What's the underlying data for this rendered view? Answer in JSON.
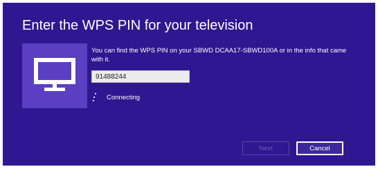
{
  "dialog": {
    "title": "Enter the WPS PIN for your television",
    "device_icon": "monitor-icon",
    "instructions": "You can find the WPS PIN on your SBWD DCAA17-SBWD100A or in the info that came with it.",
    "pin_value": "91488244",
    "status_text": "Connecting",
    "next_label": "Next",
    "cancel_label": "Cancel",
    "next_enabled": false
  },
  "colors": {
    "dialog_background": "#2e1791",
    "tile_background": "#5a3fc2",
    "text": "#ffffff"
  }
}
